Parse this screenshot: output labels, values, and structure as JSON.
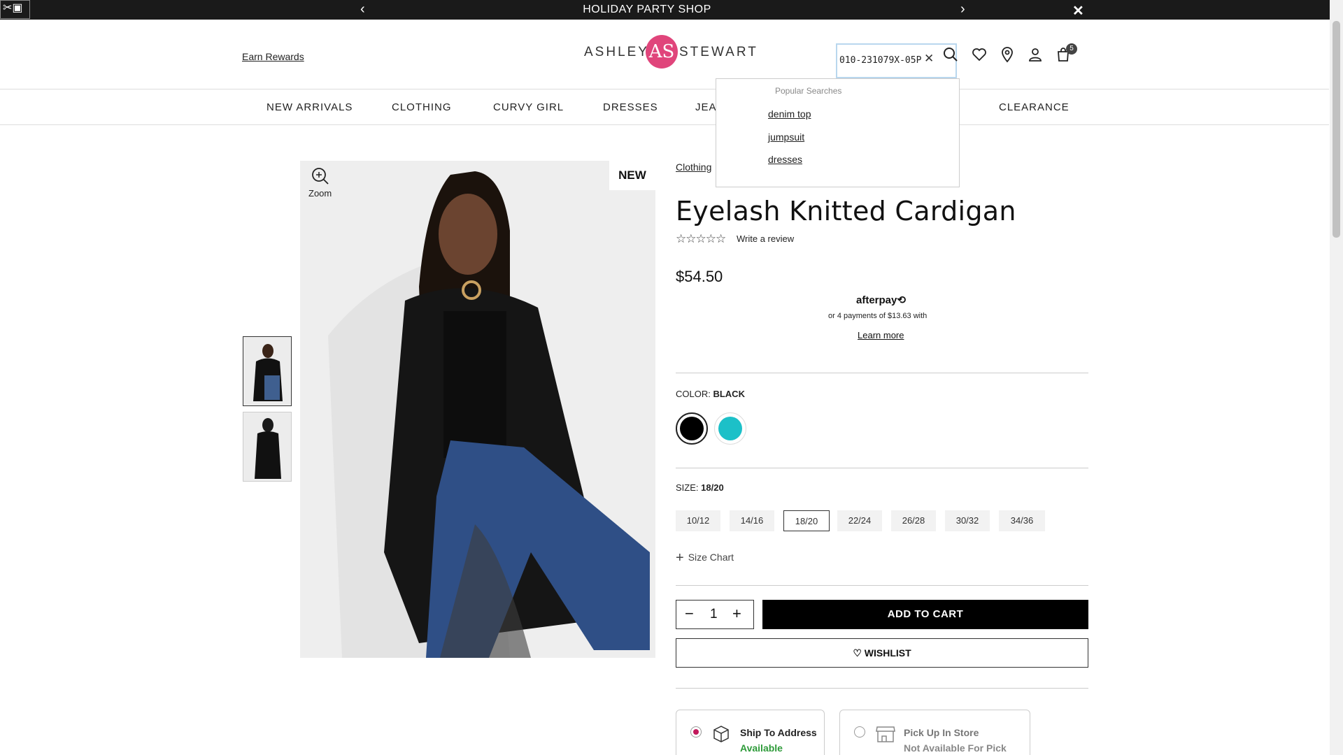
{
  "promo": {
    "title": "HOLIDAY PARTY SHOP",
    "prev_icon": "‹",
    "next_icon": "›",
    "close_icon": "✕"
  },
  "header": {
    "earn_rewards": "Earn Rewards",
    "logo_left": "ASHLEY",
    "logo_mark": "AS",
    "logo_right": "STEWART",
    "search_value": "010-231079X-05P",
    "cart_count": "5"
  },
  "nav": {
    "items": [
      "NEW ARRIVALS",
      "CLOTHING",
      "CURVY GIRL",
      "DRESSES",
      "JEA",
      "CLEARANCE"
    ]
  },
  "search_dropdown": {
    "title": "Popular Searches",
    "items": [
      "denim top",
      "jumpsuit",
      "dresses"
    ]
  },
  "gallery": {
    "zoom_label": "Zoom",
    "badge": "NEW"
  },
  "product": {
    "breadcrumb": "Clothing",
    "title": "Eyelash Knitted Cardigan",
    "stars": "☆☆☆☆☆",
    "write_review": "Write a review",
    "price": "$54.50",
    "afterpay_logo": "afterpay⟲",
    "afterpay_text": "or 4 payments of $13.63 with",
    "afterpay_link": "Learn more",
    "color_prefix": "COLOR:",
    "color_value": "BLACK",
    "colors": [
      "#000000",
      "#1cc0c8"
    ],
    "size_prefix": "SIZE:",
    "size_value": "18/20",
    "sizes": [
      "10/12",
      "14/16",
      "18/20",
      "22/24",
      "26/28",
      "30/32",
      "34/36"
    ],
    "size_chart": "Size Chart",
    "quantity": "1",
    "add_to_cart": "ADD TO CART",
    "wishlist": "WISHLIST"
  },
  "shipping": {
    "ship_title": "Ship To Address",
    "ship_status": "Available",
    "pickup_title": "Pick Up In Store",
    "pickup_status": "Not Available For Pick"
  },
  "colors": {
    "accent": "#e0457b",
    "available": "#2e9b3a",
    "unavailable": "#888888"
  }
}
